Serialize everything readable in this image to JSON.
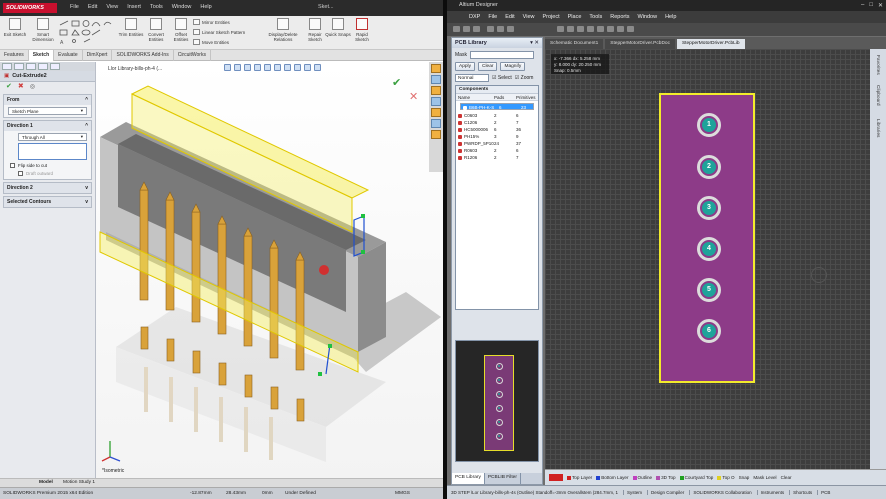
{
  "solidworks": {
    "logo": "SOLIDWORKS",
    "menu": [
      "File",
      "Edit",
      "View",
      "Insert",
      "Tools",
      "Window",
      "Help"
    ],
    "title_short": "Sket...",
    "ribbon": {
      "big": [
        "Exit Sketch",
        "Smart Dimension",
        "Trim Entities",
        "Convert Entities",
        "Offset Entities",
        "Display/Delete Relations",
        "Repair Sketch",
        "Quick Snaps",
        "Rapid Sketch"
      ],
      "small": [
        "Mirror Entities",
        "Linear Sketch Pattern",
        "Move Entities"
      ]
    },
    "tabs": [
      "Features",
      "Sketch",
      "Evaluate",
      "DimXpert",
      "SOLIDWORKS Add-Ins",
      "CircuitWorks"
    ],
    "active_tab": "Sketch",
    "property_manager": {
      "title": "Cut-Extrude2",
      "from_group": "From",
      "from_value": "Sketch Plane",
      "direction1_group": "Direction 1",
      "direction1_value": "Through All",
      "flip_label": "Flip side to cut",
      "draft_label": "Draft outward",
      "direction2_group": "Direction 2",
      "selected_contours_group": "Selected Contours"
    },
    "breadcrumb": "Llor Library-bills-ph-4 (...",
    "view_label": "*Isometric",
    "model_tabs": [
      "Model",
      "Motion Study 1"
    ],
    "status": {
      "edition": "SOLIDWORKS Premium 2015 x64 Edition",
      "x": "-12.87mm",
      "y": "28.43mm",
      "z": "0mm",
      "state": "Under Defined",
      "units": "MMGS"
    }
  },
  "altium": {
    "title": "Altium Designer",
    "menu": [
      "DXP",
      "File",
      "Edit",
      "View",
      "Project",
      "Place",
      "Tools",
      "Reports",
      "Window",
      "Help"
    ],
    "panel": {
      "title": "PCB Library",
      "mask_label": "Mask",
      "buttons": [
        "Apply",
        "Clear",
        "Magnify"
      ],
      "mode": "Normal",
      "checks": [
        "Select",
        "Zoom"
      ],
      "components_label": "Components",
      "columns": [
        "Name",
        "Pads",
        "Primitives"
      ],
      "rows": [
        {
          "name": "B6B-PH-K-S",
          "pads": "6",
          "prims": "23"
        },
        {
          "name": "C0603",
          "pads": "2",
          "prims": "6"
        },
        {
          "name": "C1206",
          "pads": "2",
          "prims": "7"
        },
        {
          "name": "HC5000006",
          "pads": "6",
          "prims": "36"
        },
        {
          "name": "PH15%",
          "pads": "3",
          "prims": "9"
        },
        {
          "name": "PWRDP_5P10",
          "pads": "24",
          "prims": "37"
        },
        {
          "name": "R0603",
          "pads": "2",
          "prims": "6"
        },
        {
          "name": "R1206",
          "pads": "2",
          "prims": "7"
        }
      ],
      "bottom_tabs": [
        "PCB Library",
        "PCBLIB Filter"
      ]
    },
    "doc_tabs": [
      "Schematic Document1",
      "StepperMotorDriver.PcbDoc",
      "StepperMotorDriver.PcbLib"
    ],
    "hud": [
      "x: -7.366  dx: 5.258 mm",
      "y: 8.000  dy: 20.250 mm",
      "Snap: 0.5mm"
    ],
    "pins": [
      "1",
      "2",
      "3",
      "4",
      "5",
      "6"
    ],
    "right_panels": [
      "Favorites",
      "Clipboard",
      "Libraries"
    ],
    "layers": [
      {
        "name": "Top Layer",
        "color": "#d02020"
      },
      {
        "name": "Bottom Layer",
        "color": "#2040d0"
      },
      {
        "name": "Outline",
        "color": "#c040c0"
      },
      {
        "name": "3D Top",
        "color": "#b050b0"
      },
      {
        "name": "Courtyard Top",
        "color": "#20a020"
      },
      {
        "name": "Top O",
        "color": "#e0d020"
      }
    ],
    "layer_tail": [
      "Snap",
      "Mask Level",
      "Clear"
    ],
    "status": [
      "3D STEP \\Lor Library-bills-ph-4s (Outline) Standoff=-3mm  Overallstem (284.7mm, 1",
      "System",
      "Design Compiler",
      "SOLIDWORKS Collaboration",
      "Instruments",
      "Shortcuts",
      "PCB"
    ]
  },
  "colors": {
    "pad": "#8d3b88",
    "pad_outline": "#f2eb2b",
    "pin_core": "#1fa39a",
    "selection": "#3399ff"
  }
}
